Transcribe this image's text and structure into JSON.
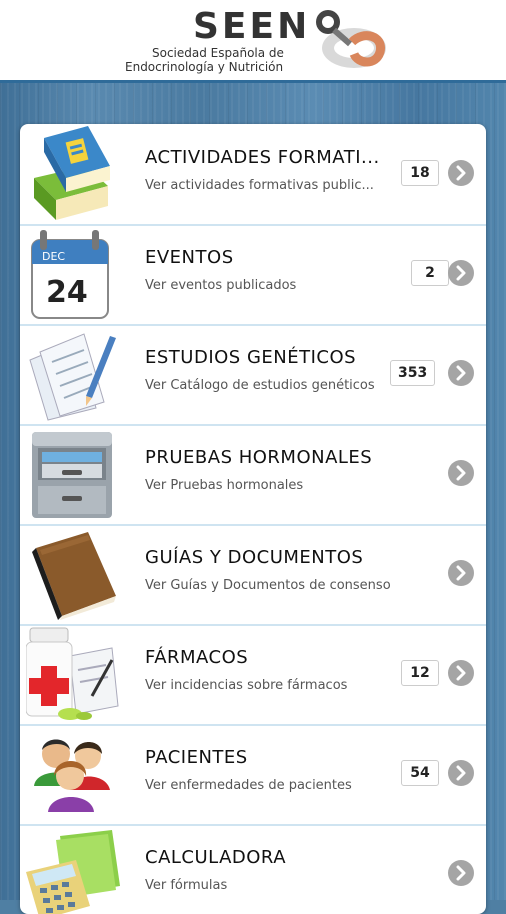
{
  "header": {
    "logo_title": "SEEN",
    "logo_line1": "Sociedad Española de",
    "logo_line2": "Endocrinología y Nutrición"
  },
  "items": [
    {
      "title": "ACTIVIDADES FORMATI...",
      "subtitle": "Ver actividades formativas public...",
      "count": "18",
      "icon": "books-icon"
    },
    {
      "title": "EVENTOS",
      "subtitle": "Ver eventos publicados",
      "count": "2",
      "icon": "calendar-icon",
      "calendar_month": "DEC",
      "calendar_day": "24"
    },
    {
      "title": "ESTUDIOS GENÉTICOS",
      "subtitle": "Ver Catálogo de estudios genéticos",
      "count": "353",
      "icon": "documents-icon"
    },
    {
      "title": "PRUEBAS HORMONALES",
      "subtitle": "Ver Pruebas hormonales",
      "count": "",
      "icon": "file-cabinet-icon"
    },
    {
      "title": "GUÍAS Y DOCUMENTOS",
      "subtitle": "Ver Guías y Documentos de consenso",
      "count": "",
      "icon": "book-icon"
    },
    {
      "title": "FÁRMACOS",
      "subtitle": "Ver incidencias sobre fármacos",
      "count": "12",
      "icon": "medicine-icon"
    },
    {
      "title": "PACIENTES",
      "subtitle": "Ver enfermedades de pacientes",
      "count": "54",
      "icon": "patients-icon"
    },
    {
      "title": "CALCULADORA",
      "subtitle": "Ver fórmulas",
      "count": "",
      "icon": "calculator-icon"
    }
  ],
  "colors": {
    "accent": "#2f6b99",
    "chevron": "#a5a5a5",
    "divider": "#cfe4f1"
  }
}
